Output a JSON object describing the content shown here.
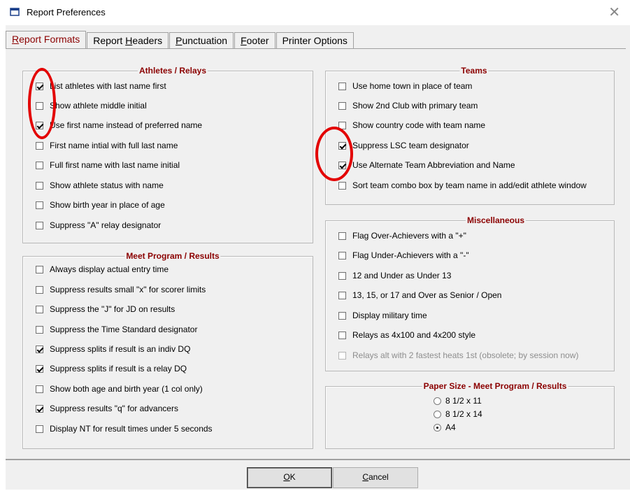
{
  "window": {
    "title": "Report Preferences",
    "close_glyph": "✕"
  },
  "tabs": [
    {
      "pre": "",
      "ul": "R",
      "post": "eport Formats"
    },
    {
      "pre": "Report ",
      "ul": "H",
      "post": "eaders"
    },
    {
      "pre": "",
      "ul": "P",
      "post": "unctuation"
    },
    {
      "pre": "",
      "ul": "F",
      "post": "ooter"
    },
    {
      "pre": "Printer Options",
      "ul": "",
      "post": ""
    }
  ],
  "athletes": {
    "legend": "Athletes / Relays",
    "items": [
      {
        "label": "List athletes with last name first",
        "checked": true
      },
      {
        "label": "Show athlete middle initial",
        "checked": false
      },
      {
        "label": "Use first name instead of preferred name",
        "checked": true
      },
      {
        "label": "First name intial with full last name",
        "checked": false
      },
      {
        "label": "Full first name with last name initial",
        "checked": false
      },
      {
        "label": "Show athlete status with name",
        "checked": false
      },
      {
        "label": "Show birth year in place of age",
        "checked": false
      },
      {
        "label": "Suppress \"A\" relay designator",
        "checked": false
      }
    ]
  },
  "meet": {
    "legend": "Meet Program / Results",
    "items": [
      {
        "label": "Always display actual entry time",
        "checked": false
      },
      {
        "label": "Suppress results small \"x\" for scorer limits",
        "checked": false
      },
      {
        "label": "Suppress the \"J\" for JD on results",
        "checked": false
      },
      {
        "label": "Suppress the Time Standard designator",
        "checked": false
      },
      {
        "label": "Suppress splits if result is an indiv DQ",
        "checked": true
      },
      {
        "label": "Suppress splits if result is a relay DQ",
        "checked": true
      },
      {
        "label": "Show both age and birth year (1 col only)",
        "checked": false
      },
      {
        "label": "Suppress results \"q\" for advancers",
        "checked": true
      },
      {
        "label": "Display NT for result times under 5 seconds",
        "checked": false
      }
    ]
  },
  "teams": {
    "legend": "Teams",
    "items": [
      {
        "label": "Use home town in place of team",
        "checked": false
      },
      {
        "label": "Show 2nd Club with primary team",
        "checked": false
      },
      {
        "label": "Show country code with team name",
        "checked": false
      },
      {
        "label": "Suppress LSC team designator",
        "checked": true
      },
      {
        "label": "Use Alternate Team Abbreviation and Name",
        "checked": true
      },
      {
        "label": "Sort team combo box by team name in add/edit athlete window",
        "checked": false
      }
    ]
  },
  "misc": {
    "legend": "Miscellaneous",
    "items": [
      {
        "label": "Flag Over-Achievers with a \"+\"",
        "checked": false
      },
      {
        "label": "Flag Under-Achievers with a \"-\"",
        "checked": false
      },
      {
        "label": "12 and Under as Under 13",
        "checked": false
      },
      {
        "label": "13, 15, or 17 and Over as Senior / Open",
        "checked": false
      },
      {
        "label": "Display military time",
        "checked": false
      },
      {
        "label": "Relays as 4x100 and 4x200 style",
        "checked": false
      },
      {
        "label": "Relays alt with 2 fastest heats 1st (obsolete; by session now)",
        "checked": false,
        "disabled": true
      }
    ]
  },
  "paper": {
    "legend": "Paper Size - Meet Program / Results",
    "options": [
      {
        "label": "8 1/2 x 11",
        "checked": false
      },
      {
        "label": "8 1/2 x 14",
        "checked": false
      },
      {
        "label": "A4",
        "checked": true
      }
    ]
  },
  "buttons": {
    "ok": {
      "ul": "O",
      "post": "K"
    },
    "cancel": {
      "ul": "C",
      "post": "ancel"
    }
  },
  "colors": {
    "legend": "#8b0000",
    "annotation_circle": "#e30000",
    "dialog_bg": "#f0f0f0"
  }
}
